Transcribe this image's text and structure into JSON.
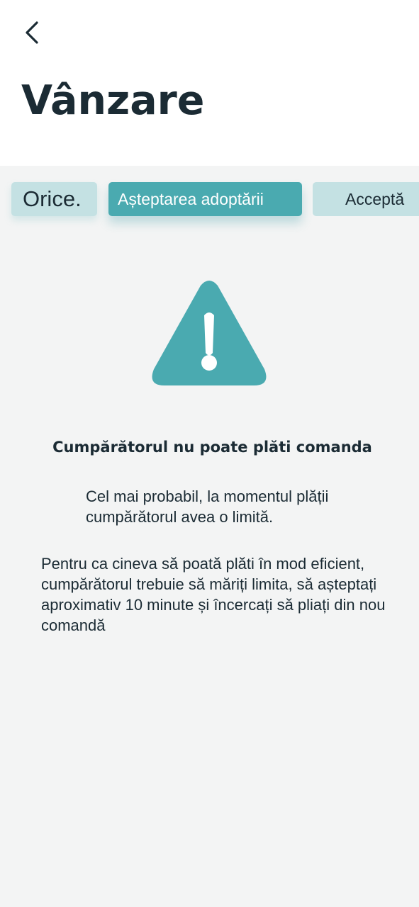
{
  "header": {
    "title": "Vânzare",
    "back_icon": "chevron-left-icon"
  },
  "tabs": [
    {
      "label": "Orice.",
      "active": false
    },
    {
      "label": "Așteptarea adoptării",
      "active": true
    },
    {
      "label": "Acceptă",
      "active": false
    }
  ],
  "error": {
    "icon": "warning-icon",
    "title": "Cumpărătorul nu poate plăti comanda",
    "message_1": "Cel mai probabil, la momentul plății cumpărătorul avea o limită.",
    "message_2": "Pentru ca cineva să poată plăti în mod eficient, cumpărătorul trebuie să măriți limita, să așteptați aproximativ 10 minute și încercați să pliați din nou comandă"
  },
  "colors": {
    "accent": "#4aaab0",
    "tab_inactive_bg": "#c4e1e3",
    "page_background": "#f3f4f4",
    "header_background": "#ffffff",
    "text_dark": "#1b2b34"
  }
}
